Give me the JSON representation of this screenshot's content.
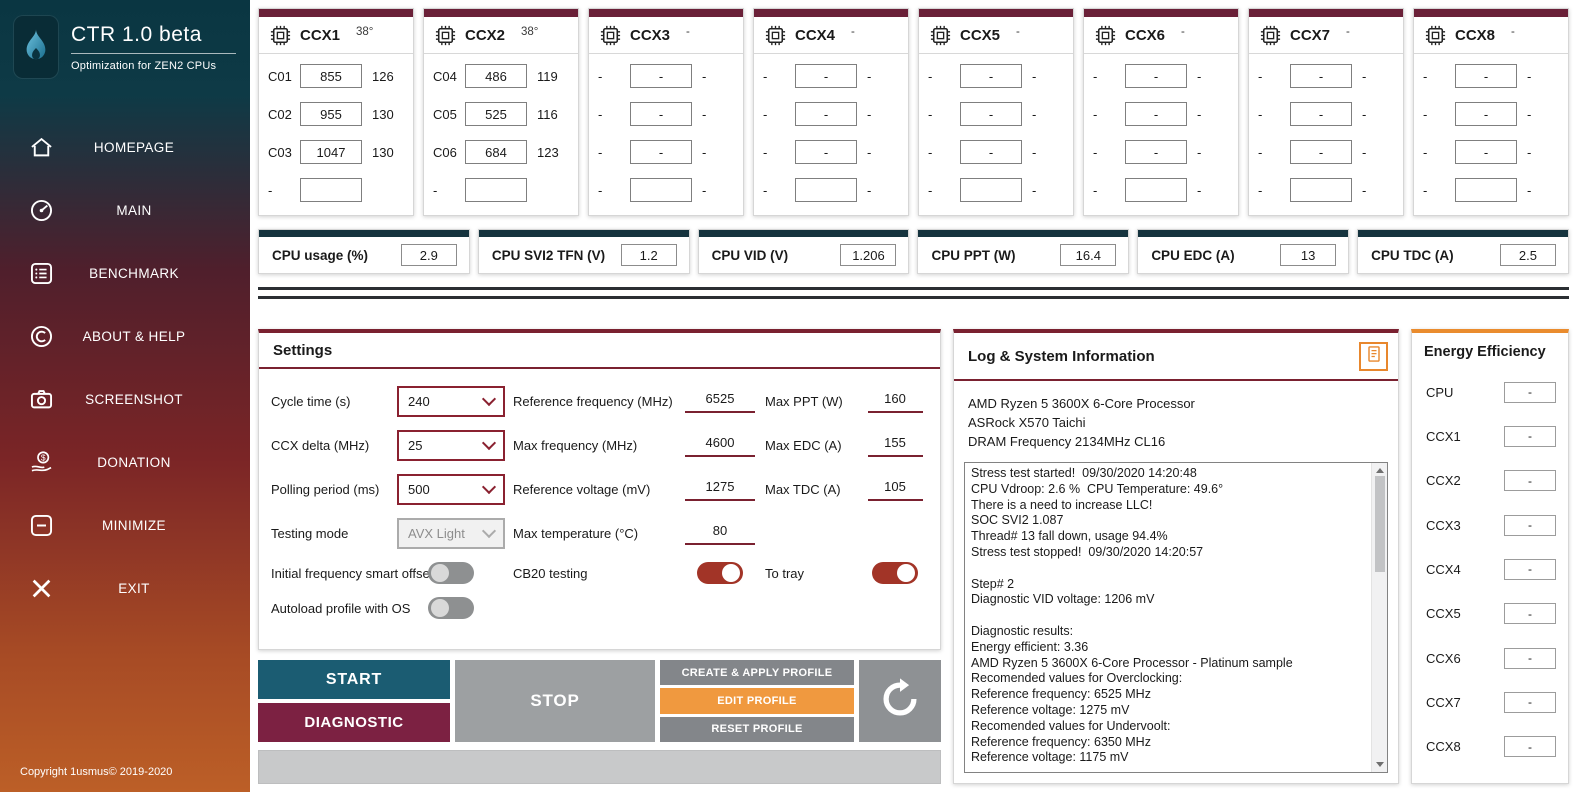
{
  "sidebar": {
    "logo_title": "CTR 1.0 beta",
    "logo_subtitle": "Optimization for ZEN2 CPUs",
    "items": [
      {
        "label": "HOMEPAGE",
        "icon": "home-icon"
      },
      {
        "label": "MAIN",
        "icon": "gauge-icon"
      },
      {
        "label": "BENCHMARK",
        "icon": "benchmark-list-icon"
      },
      {
        "label": "ABOUT & HELP",
        "icon": "copyright-icon"
      },
      {
        "label": "SCREENSHOT",
        "icon": "camera-icon"
      },
      {
        "label": "DONATION",
        "icon": "donation-icon"
      },
      {
        "label": "MINIMIZE",
        "icon": "minimize-icon"
      },
      {
        "label": "EXIT",
        "icon": "exit-icon"
      }
    ],
    "copyright": "Copyright 1usmus© 2019-2020"
  },
  "ccx_panels": [
    {
      "title": "CCX1",
      "temp": "38°",
      "rows": [
        {
          "label": "C01",
          "value": "855",
          "extra": "126"
        },
        {
          "label": "C02",
          "value": "955",
          "extra": "130"
        },
        {
          "label": "C03",
          "value": "1047",
          "extra": "130"
        },
        {
          "label": "-",
          "value": "",
          "extra": ""
        }
      ]
    },
    {
      "title": "CCX2",
      "temp": "38°",
      "rows": [
        {
          "label": "C04",
          "value": "486",
          "extra": "119"
        },
        {
          "label": "C05",
          "value": "525",
          "extra": "116"
        },
        {
          "label": "C06",
          "value": "684",
          "extra": "123"
        },
        {
          "label": "-",
          "value": "",
          "extra": ""
        }
      ]
    },
    {
      "title": "CCX3",
      "temp": "-",
      "rows": [
        {
          "label": "-",
          "value": "-",
          "extra": "-"
        },
        {
          "label": "-",
          "value": "-",
          "extra": "-"
        },
        {
          "label": "-",
          "value": "-",
          "extra": "-"
        },
        {
          "label": "-",
          "value": "",
          "extra": "-"
        }
      ]
    },
    {
      "title": "CCX4",
      "temp": "-",
      "rows": [
        {
          "label": "-",
          "value": "-",
          "extra": "-"
        },
        {
          "label": "-",
          "value": "-",
          "extra": "-"
        },
        {
          "label": "-",
          "value": "-",
          "extra": "-"
        },
        {
          "label": "-",
          "value": "",
          "extra": "-"
        }
      ]
    },
    {
      "title": "CCX5",
      "temp": "-",
      "rows": [
        {
          "label": "-",
          "value": "-",
          "extra": "-"
        },
        {
          "label": "-",
          "value": "-",
          "extra": "-"
        },
        {
          "label": "-",
          "value": "-",
          "extra": "-"
        },
        {
          "label": "-",
          "value": "",
          "extra": "-"
        }
      ]
    },
    {
      "title": "CCX6",
      "temp": "-",
      "rows": [
        {
          "label": "-",
          "value": "-",
          "extra": "-"
        },
        {
          "label": "-",
          "value": "-",
          "extra": "-"
        },
        {
          "label": "-",
          "value": "-",
          "extra": "-"
        },
        {
          "label": "-",
          "value": "",
          "extra": "-"
        }
      ]
    },
    {
      "title": "CCX7",
      "temp": "-",
      "rows": [
        {
          "label": "-",
          "value": "-",
          "extra": "-"
        },
        {
          "label": "-",
          "value": "-",
          "extra": "-"
        },
        {
          "label": "-",
          "value": "-",
          "extra": "-"
        },
        {
          "label": "-",
          "value": "",
          "extra": "-"
        }
      ]
    },
    {
      "title": "CCX8",
      "temp": "-",
      "rows": [
        {
          "label": "-",
          "value": "-",
          "extra": "-"
        },
        {
          "label": "-",
          "value": "-",
          "extra": "-"
        },
        {
          "label": "-",
          "value": "-",
          "extra": "-"
        },
        {
          "label": "-",
          "value": "",
          "extra": "-"
        }
      ]
    }
  ],
  "stats": [
    {
      "label": "CPU usage (%)",
      "value": "2.9"
    },
    {
      "label": "CPU SVI2 TFN (V)",
      "value": "1.2"
    },
    {
      "label": "CPU VID (V)",
      "value": "1.206"
    },
    {
      "label": "CPU PPT (W)",
      "value": "16.4"
    },
    {
      "label": "CPU EDC (A)",
      "value": "13"
    },
    {
      "label": "CPU TDC (A)",
      "value": "2.5"
    }
  ],
  "settings": {
    "title": "Settings",
    "cycle_time": {
      "label": "Cycle time (s)",
      "value": "240"
    },
    "ccx_delta": {
      "label": "CCX delta (MHz)",
      "value": "25"
    },
    "polling": {
      "label": "Polling period (ms)",
      "value": "500"
    },
    "testing_mode": {
      "label": "Testing mode",
      "value": "AVX Light"
    },
    "ref_freq": {
      "label": "Reference frequency (MHz)",
      "value": "6525"
    },
    "max_freq": {
      "label": "Max frequency (MHz)",
      "value": "4600"
    },
    "ref_volt": {
      "label": "Reference voltage (mV)",
      "value": "1275"
    },
    "max_temp": {
      "label": "Max temperature (°C)",
      "value": "80"
    },
    "max_ppt": {
      "label": "Max PPT (W)",
      "value": "160"
    },
    "max_edc": {
      "label": "Max EDC (A)",
      "value": "155"
    },
    "max_tdc": {
      "label": "Max TDC (A)",
      "value": "105"
    },
    "smart_offset": {
      "label": "Initial frequency smart offset",
      "on": false
    },
    "cb20": {
      "label": "CB20 testing",
      "on": true
    },
    "to_tray": {
      "label": "To tray",
      "on": true
    },
    "autoload": {
      "label": "Autoload profile with OS",
      "on": false
    }
  },
  "actions": {
    "start": "START",
    "diagnostic": "DIAGNOSTIC",
    "stop": "STOP",
    "create_profile": "CREATE & APPLY PROFILE",
    "edit_profile": "EDIT PROFILE",
    "reset_profile": "RESET PROFILE"
  },
  "log": {
    "title": "Log & System Information",
    "system": [
      "AMD Ryzen 5 3600X 6-Core Processor",
      "ASRock X570 Taichi",
      "DRAM Frequency 2134MHz CL16"
    ],
    "text": "Stress test started!  09/30/2020 14:20:48\nCPU Vdroop: 2.6 %  CPU Temperature: 49.6°\nThere is a need to increase LLC!\nSOC SVI2 1.087\nThread# 13 fall down, usage 94.4%\nStress test stopped!  09/30/2020 14:20:57\n\nStep# 2\nDiagnostic VID voltage: 1206 mV\n\nDiagnostic results:\nEnergy efficient: 3.36\nAMD Ryzen 5 3600X 6-Core Processor - Platinum sample\nRecomended values for Overclocking:\nReference frequency: 6525 MHz\nReference voltage: 1275 mV\nRecomended values for Undervoolt:\nReference frequency: 6350 MHz\nReference voltage: 1175 mV"
  },
  "energy": {
    "title": "Energy Efficiency",
    "rows": [
      {
        "label": "CPU",
        "value": "-"
      },
      {
        "label": "CCX1",
        "value": "-"
      },
      {
        "label": "CCX2",
        "value": "-"
      },
      {
        "label": "CCX3",
        "value": "-"
      },
      {
        "label": "CCX4",
        "value": "-"
      },
      {
        "label": "CCX5",
        "value": "-"
      },
      {
        "label": "CCX6",
        "value": "-"
      },
      {
        "label": "CCX7",
        "value": "-"
      },
      {
        "label": "CCX8",
        "value": "-"
      }
    ]
  },
  "colors": {
    "maroon_accent": "#7a2130",
    "navy_accent": "#15333e",
    "orange_accent": "#ea8c2e",
    "teal_button": "#1b5c72",
    "edit_orange": "#f0993f",
    "toggle_on": "#a23427"
  }
}
